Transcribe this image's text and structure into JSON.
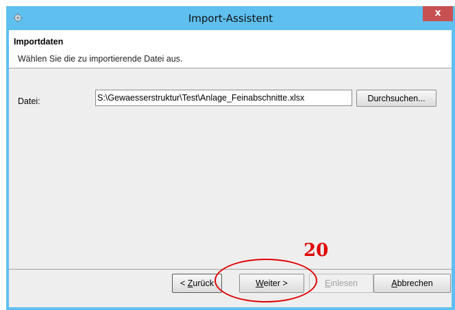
{
  "window": {
    "title": "Import-Assistent",
    "close_glyph": "x",
    "app_icon": "gear-icon",
    "accent_color": "#5fbfee"
  },
  "header": {
    "title": "Importdaten",
    "subtitle": "Wählen Sie die zu importierende Datei aus."
  },
  "form": {
    "file_label": "Datei:",
    "file_value": "S:\\Gewaesserstruktur\\Test\\Anlage_Feinabschnitte.xlsx",
    "browse_label": "Durchsuchen..."
  },
  "buttons": {
    "back": {
      "prefix": "< ",
      "mnemonic": "Z",
      "rest": "urück"
    },
    "next": {
      "mnemonic": "W",
      "rest": "eiter >"
    },
    "load": {
      "mnemonic": "E",
      "rest": "inlesen"
    },
    "cancel": {
      "mnemonic": "A",
      "rest": "bbrechen"
    }
  },
  "annotation": {
    "number": "20",
    "color": "#e00000"
  }
}
